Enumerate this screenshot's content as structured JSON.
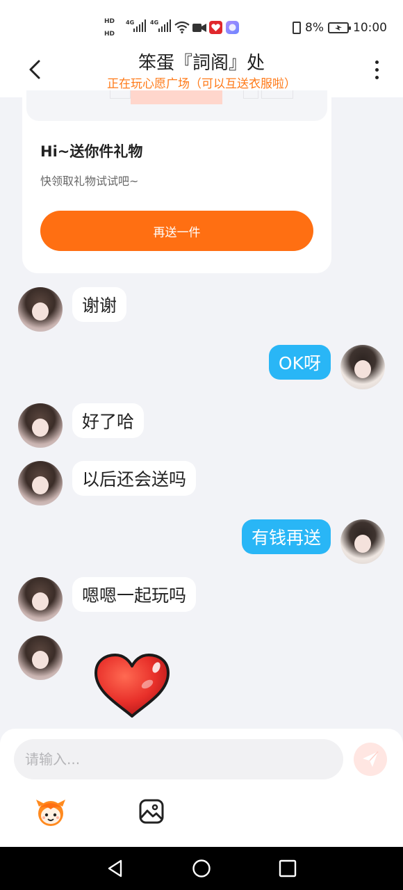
{
  "status_bar": {
    "battery_percent": "8%",
    "time": "10:00",
    "hd1": "HD",
    "hd2": "HD",
    "net1": "4G",
    "net2": "4G"
  },
  "header": {
    "title": "笨蛋『詞阁』处",
    "subtitle": "正在玩心愿广场（可以互送衣服啦）"
  },
  "gift_card": {
    "title": "Hi~送你件礼物",
    "description": "快领取礼物试试吧~",
    "button_label": "再送一件"
  },
  "messages": [
    {
      "sender": "other",
      "text": "谢谢"
    },
    {
      "sender": "self",
      "text": "OK呀"
    },
    {
      "sender": "other",
      "text": "好了哈"
    },
    {
      "sender": "other",
      "text": "以后还会送吗"
    },
    {
      "sender": "self",
      "text": "有钱再送"
    },
    {
      "sender": "other",
      "text": "嗯嗯一起玩吗"
    },
    {
      "sender": "other",
      "sticker": "heart-sticker"
    }
  ],
  "input": {
    "placeholder": "请输入..."
  },
  "icons": {
    "back": "chevron-left-icon",
    "more": "more-vertical-icon",
    "send": "paper-plane-icon",
    "emoji": "mascot-emoji-icon",
    "image": "image-icon",
    "nav_back": "triangle-back-icon",
    "nav_home": "circle-home-icon",
    "nav_recent": "square-recent-icon"
  },
  "colors": {
    "accent_orange": "#ff6f12",
    "subtitle_orange": "#ff7a18",
    "self_bubble": "#29b6f6",
    "background": "#f2f3f7",
    "heart_red": "#e8302a"
  }
}
